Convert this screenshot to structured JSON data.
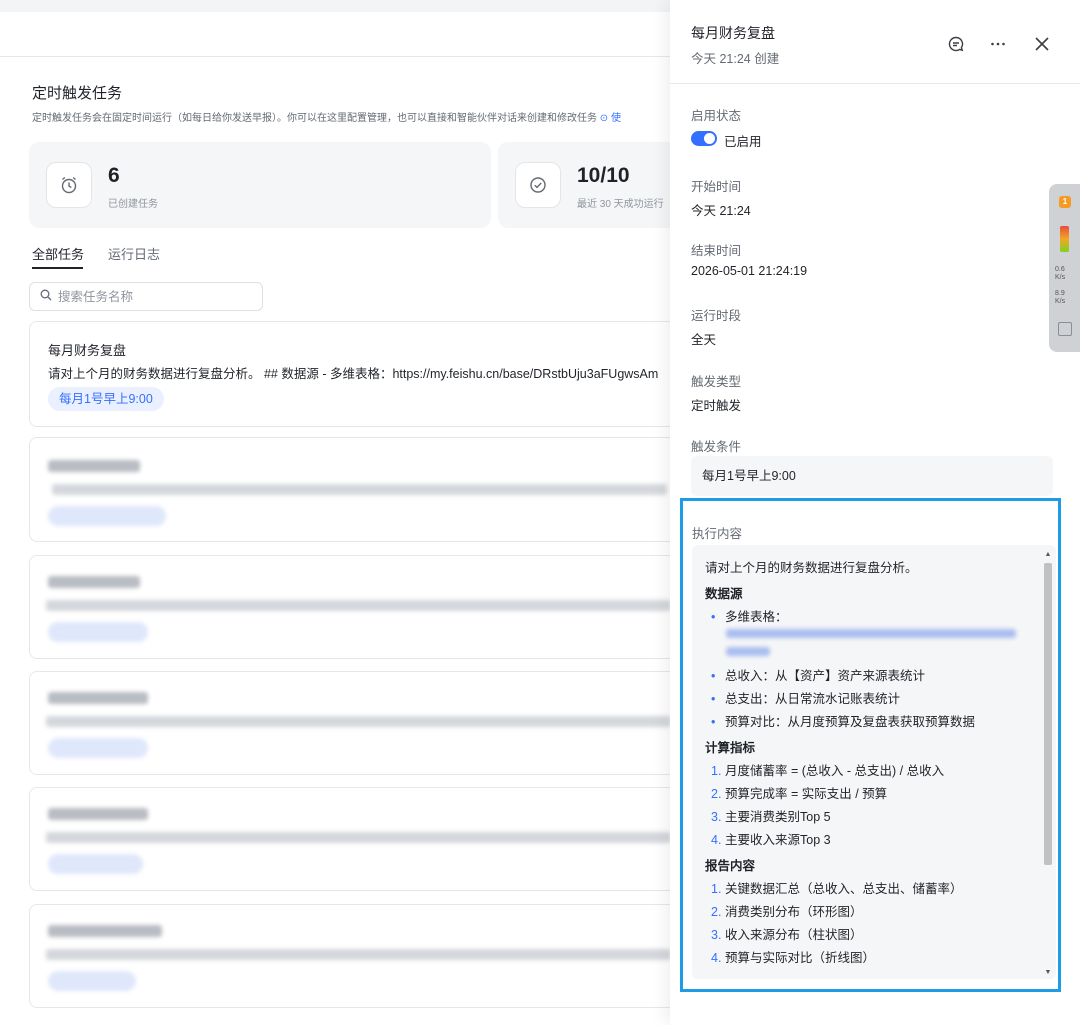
{
  "main": {
    "page_title": "定时触发任务",
    "page_desc": "定时触发任务会在固定时间运行（如每日给你发送早报）。你可以在这里配置管理，也可以直接和智能伙伴对话来创建和修改任务",
    "page_desc_help": "⊙ 使",
    "stats": [
      {
        "value": "6",
        "label": "已创建任务",
        "icon": "alarm-clock-icon"
      },
      {
        "value": "10/10",
        "label": "最近 30 天成功运行",
        "icon": "check-circle-icon"
      }
    ],
    "tabs": [
      {
        "label": "全部任务",
        "active": true
      },
      {
        "label": "运行日志",
        "active": false
      }
    ],
    "search": {
      "placeholder": "搜索任务名称",
      "icon": "search-icon"
    },
    "tasks": [
      {
        "title": "每月财务复盘",
        "desc": "请对上个月的财务数据进行复盘分析。 ## 数据源 - 多维表格：https://my.feishu.cn/base/DRstbUju3aFUgwsAm",
        "tag": "每月1号早上9:00"
      }
    ]
  },
  "panel": {
    "title": "每月财务复盘",
    "subtitle": "今天 21:24 创建",
    "icons": [
      "comment-icon",
      "more-icon",
      "close-icon"
    ],
    "fields": {
      "status_label": "启用状态",
      "status_value": "已启用",
      "start_label": "开始时间",
      "start_value": "今天 21:24",
      "end_label": "结束时间",
      "end_value": "2026-05-01 21:24:19",
      "period_label": "运行时段",
      "period_value": "全天",
      "trigger_type_label": "触发类型",
      "trigger_type_value": "定时触发",
      "condition_label": "触发条件",
      "condition_value": "每月1号早上9:00",
      "exec_label": "执行内容"
    },
    "exec": {
      "intro": "请对上个月的财务数据进行复盘分析。",
      "h_source": "数据源",
      "source_items": [
        "多维表格：",
        "总收入：从【资产】资产来源表统计",
        "总支出：从日常流水记账表统计",
        "预算对比：从月度预算及复盘表获取预算数据"
      ],
      "h_metrics": "计算指标",
      "metric_items": [
        {
          "n": "1.",
          "text": "月度储蓄率 = (总收入 - 总支出) / 总收入"
        },
        {
          "n": "2.",
          "text": "预算完成率 = 实际支出 / 预算"
        },
        {
          "n": "3.",
          "text": "主要消费类别Top 5"
        },
        {
          "n": "4.",
          "text": "主要收入来源Top 3"
        }
      ],
      "h_report": "报告内容",
      "report_items": [
        {
          "n": "1.",
          "text": "关键数据汇总（总收入、总支出、储蓄率）"
        },
        {
          "n": "2.",
          "text": "消费类别分布（环形图）"
        },
        {
          "n": "3.",
          "text": "收入来源分布（柱状图）"
        },
        {
          "n": "4.",
          "text": "预算与实际对比（折线图）"
        }
      ]
    }
  },
  "side_widget": {
    "badge": "1",
    "stat1": "0.6",
    "stat1_unit": "K/s",
    "stat2": "8.9",
    "stat2_unit": "K/s"
  },
  "colors": {
    "accent": "#3370ff",
    "highlight_frame": "#1e9ce5",
    "tag_bg": "#eaf0ff"
  }
}
